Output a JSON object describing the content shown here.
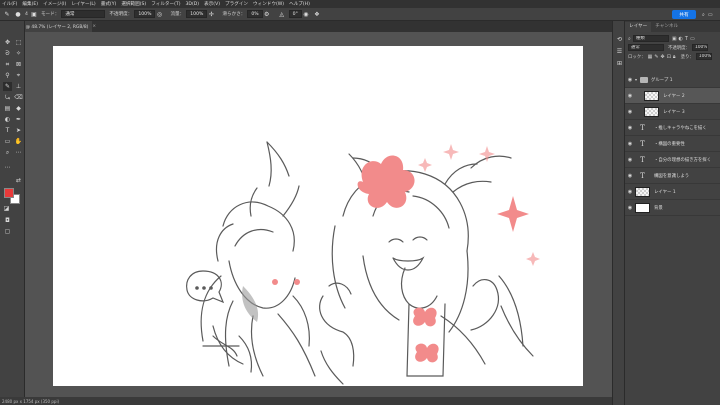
{
  "menu": [
    "イル(F)",
    "編集(E)",
    "イメージ(I)",
    "レイヤー(L)",
    "書式(Y)",
    "選択範囲(S)",
    "フィルター(T)",
    "3D(D)",
    "表示(V)",
    "プラグイン",
    "ウィンドウ(W)",
    "ヘルプ(H)"
  ],
  "options": {
    "mode_label": "モード：",
    "mode_value": "通常",
    "opacity_label": "不透明度：",
    "opacity_value": "100%",
    "flow_label": "流量：",
    "flow_value": "100%",
    "smoothing_label": "滑らかさ：",
    "smoothing_value": "0%",
    "angle_value": "0°",
    "brush_size": "4",
    "share_label": "共有"
  },
  "document": {
    "tab_title": "7.画像.psd @ 48.7% (レイヤー 2, RGB/8)",
    "tab_close": "×",
    "status": "2480 px x 1754 px (350 ppi)"
  },
  "layers_panel": {
    "tabs": [
      "レイヤー",
      "チャンネル"
    ],
    "filter_label": "種類",
    "blend_mode": "通常",
    "opacity_label": "不透明度：",
    "opacity_value": "100%",
    "lock_label": "ロック：",
    "fill_label": "塗り：",
    "fill_value": "100%",
    "layers": [
      {
        "name": "グループ 1",
        "kind": "group"
      },
      {
        "name": "レイヤー 2",
        "kind": "raster",
        "selected": true
      },
      {
        "name": "レイヤー 3",
        "kind": "raster"
      },
      {
        "name": "・推しキャラやねこを描く",
        "kind": "text"
      },
      {
        "name": "・構図の重要性",
        "kind": "text"
      },
      {
        "name": "・自分の理想の描き方を探く",
        "kind": "text"
      },
      {
        "name": "構図を意識しよう",
        "kind": "text"
      },
      {
        "name": "レイヤー 1",
        "kind": "raster"
      },
      {
        "name": "背景",
        "kind": "background"
      }
    ]
  },
  "colors": {
    "foreground": "#e83a3a",
    "background": "#ffffff",
    "accent": "#1473e6",
    "sketch_pink": "#f28b8b"
  }
}
